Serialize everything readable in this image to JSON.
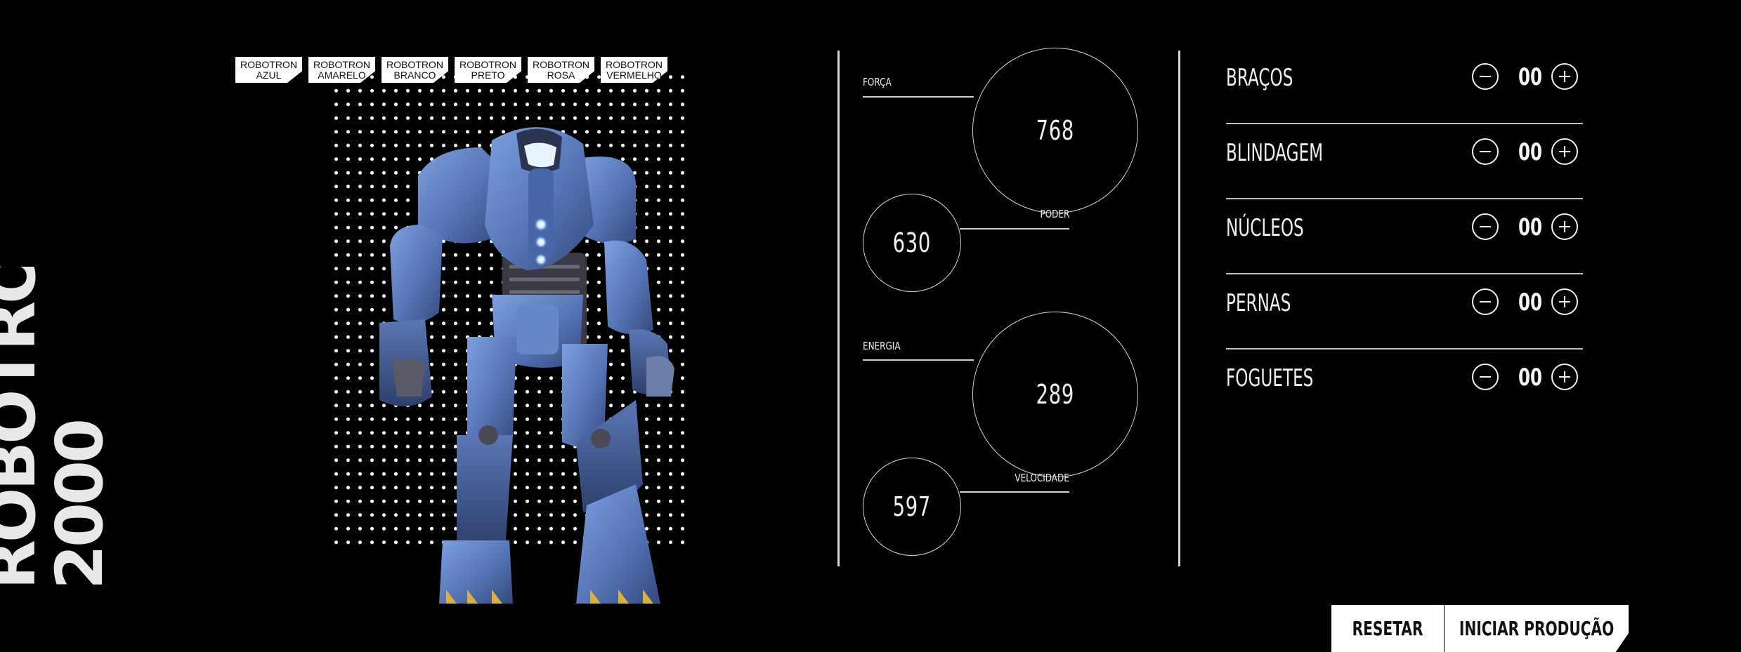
{
  "brand": {
    "line1": "ROBOTRON",
    "line2": "2000"
  },
  "color_tabs": [
    {
      "line1": "ROBOTRON",
      "line2": "AZUL"
    },
    {
      "line1": "ROBOTRON",
      "line2": "AMARELO"
    },
    {
      "line1": "ROBOTRON",
      "line2": "BRANCO"
    },
    {
      "line1": "ROBOTRON",
      "line2": "PRETO"
    },
    {
      "line1": "ROBOTRON",
      "line2": "ROSA"
    },
    {
      "line1": "ROBOTRON",
      "line2": "VERMELHO"
    }
  ],
  "robot": {
    "color": "#5b7fc0"
  },
  "stats": {
    "forca": {
      "label": "FORÇA",
      "value": "768"
    },
    "poder": {
      "label": "PODER",
      "value": "630"
    },
    "energia": {
      "label": "ENERGIA",
      "value": "289"
    },
    "velocidade": {
      "label": "VELOCIDADE",
      "value": "597"
    }
  },
  "parts": [
    {
      "name": "BRAÇOS",
      "count": "00"
    },
    {
      "name": "BLINDAGEM",
      "count": "00"
    },
    {
      "name": "NÚCLEOS",
      "count": "00"
    },
    {
      "name": "PERNAS",
      "count": "00"
    },
    {
      "name": "FOGUETES",
      "count": "00"
    }
  ],
  "actions": {
    "reset": "RESETAR",
    "start": "INICIAR PRODUÇÃO"
  },
  "colors": {
    "background": "#000000",
    "foreground": "#ffffff"
  }
}
